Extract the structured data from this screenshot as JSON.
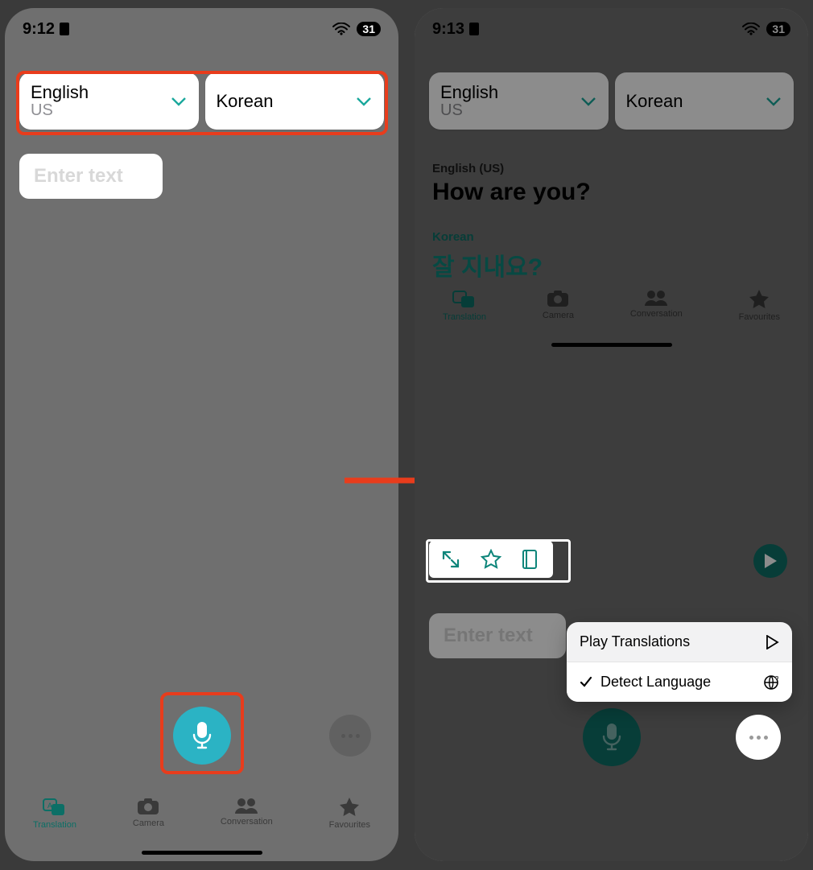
{
  "left": {
    "status": {
      "time": "9:12",
      "battery": "31"
    },
    "source_lang": {
      "name": "English",
      "sub": "US"
    },
    "target_lang": {
      "name": "Korean"
    },
    "input_placeholder": "Enter text",
    "tabs": [
      {
        "id": "translation",
        "label": "Translation",
        "active": true
      },
      {
        "id": "camera",
        "label": "Camera",
        "active": false
      },
      {
        "id": "conversation",
        "label": "Conversation",
        "active": false
      },
      {
        "id": "favourites",
        "label": "Favourites",
        "active": false
      }
    ]
  },
  "right": {
    "status": {
      "time": "9:13",
      "battery": "31"
    },
    "source_lang": {
      "name": "English",
      "sub": "US"
    },
    "target_lang": {
      "name": "Korean"
    },
    "source_label": "English (US)",
    "source_text": "How are you?",
    "target_label": "Korean",
    "target_text": "잘 지내요?",
    "input_placeholder": "Enter text",
    "menu": {
      "play": "Play Translations",
      "detect": "Detect Language"
    },
    "tabs": [
      {
        "id": "translation",
        "label": "Translation",
        "active": true
      },
      {
        "id": "camera",
        "label": "Camera",
        "active": false
      },
      {
        "id": "conversation",
        "label": "Conversation",
        "active": false
      },
      {
        "id": "favourites",
        "label": "Favourites",
        "active": false
      }
    ]
  }
}
